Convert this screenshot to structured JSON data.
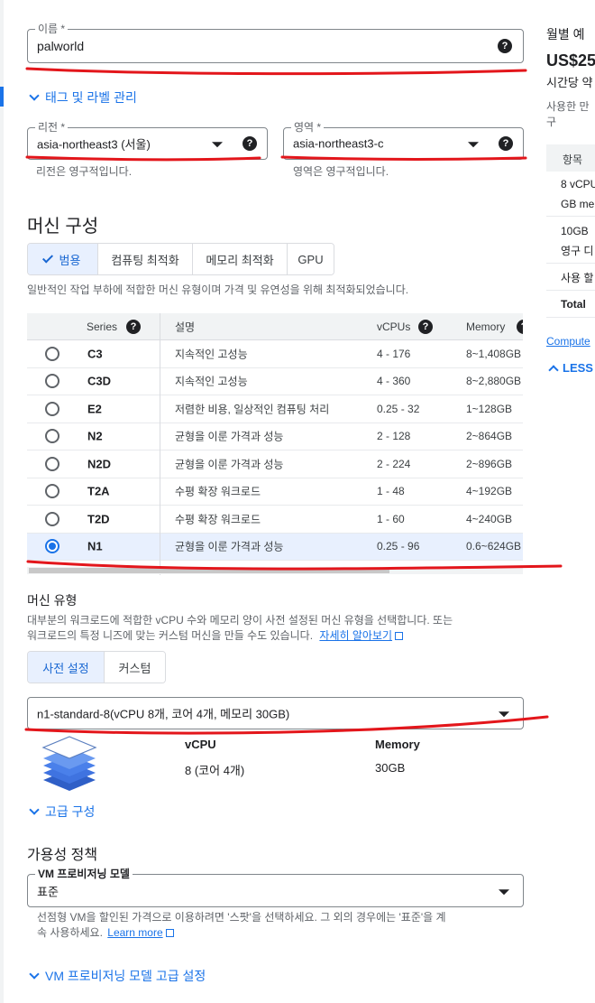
{
  "name_field": {
    "label": "이름 *",
    "value": "palworld"
  },
  "tags_link": "태그 및 라벨 관리",
  "region": {
    "label": "리전 *",
    "value": "asia-northeast3 (서울)",
    "hint": "리전은 영구적입니다."
  },
  "zone": {
    "label": "영역 *",
    "value": "asia-northeast3-c",
    "hint": "영역은 영구적입니다."
  },
  "machine_config": {
    "title": "머신 구성",
    "families": [
      {
        "label": "범용",
        "active": true
      },
      {
        "label": "컴퓨팅 최적화",
        "active": false
      },
      {
        "label": "메모리 최적화",
        "active": false
      },
      {
        "label": "GPU",
        "active": false
      }
    ],
    "family_desc": "일반적인 작업 부하에 적합한 머신 유형이며 가격 및 유연성을 위해 최적화되었습니다.",
    "columns": {
      "series": "Series",
      "desc": "설명",
      "vcpus": "vCPUs",
      "memory": "Memory"
    },
    "series": [
      {
        "name": "C3",
        "desc": "지속적인 고성능",
        "vcpus": "4 - 176",
        "memory": "8~1,408GB",
        "selected": false
      },
      {
        "name": "C3D",
        "desc": "지속적인 고성능",
        "vcpus": "4 - 360",
        "memory": "8~2,880GB",
        "selected": false
      },
      {
        "name": "E2",
        "desc": "저렴한 비용, 일상적인 컴퓨팅 처리",
        "vcpus": "0.25 - 32",
        "memory": "1~128GB",
        "selected": false
      },
      {
        "name": "N2",
        "desc": "균형을 이룬 가격과 성능",
        "vcpus": "2 - 128",
        "memory": "2~864GB",
        "selected": false
      },
      {
        "name": "N2D",
        "desc": "균형을 이룬 가격과 성능",
        "vcpus": "2 - 224",
        "memory": "2~896GB",
        "selected": false
      },
      {
        "name": "T2A",
        "desc": "수평 확장 워크로드",
        "vcpus": "1 - 48",
        "memory": "4~192GB",
        "selected": false
      },
      {
        "name": "T2D",
        "desc": "수평 확장 워크로드",
        "vcpus": "1 - 60",
        "memory": "4~240GB",
        "selected": false
      },
      {
        "name": "N1",
        "desc": "균형을 이룬 가격과 성능",
        "vcpus": "0.25 - 96",
        "memory": "0.6~624GB",
        "selected": true
      }
    ]
  },
  "machine_type": {
    "title": "머신 유형",
    "desc_line1": "대부분의 워크로드에 적합한 vCPU 수와 메모리 양이 사전 설정된 머신 유형을 선택합니다. 또는",
    "desc_line2": "워크로드의 특정 니즈에 맞는 커스텀 머신을 만들 수도 있습니다.",
    "learn_more": "자세히 알아보기",
    "tabs": [
      {
        "label": "사전 설정",
        "active": true
      },
      {
        "label": "커스텀",
        "active": false
      }
    ],
    "selected": "n1-standard-8(vCPU 8개, 코어 4개, 메모리 30GB)",
    "vcpu_label": "vCPU",
    "vcpu_value": "8 (코어 4개)",
    "memory_label": "Memory",
    "memory_value": "30GB"
  },
  "advanced_link": "고급 구성",
  "availability": {
    "title": "가용성 정책",
    "provisioning_label": "VM 프로비저닝 모델",
    "provisioning_value": "표준",
    "desc_line1": "선점형 VM을 할인된 가격으로 이용하려면 '스팟'을 선택하세요. 그 외의 경우에는 '표준'을 계",
    "desc_line2": "속 사용하세요.",
    "learn_more": "Learn more",
    "advanced_link": "VM 프로비저닝 모델 고급 설정"
  },
  "estimate_panel": {
    "title": "월별 예",
    "price": "US$25",
    "hourly": "시간당 약",
    "usage_line1": "사용한 만",
    "usage_line2": "구",
    "col_header": "항목",
    "rows": [
      [
        "8 vCPU",
        "GB me"
      ],
      [
        "10GB",
        "영구 디"
      ],
      [
        "사용 할"
      ]
    ],
    "total": "Total",
    "compute_link": "Compute",
    "less_link": "LESS"
  },
  "colors": {
    "accent": "#1a73e8",
    "annotation": "#e3161b",
    "selected_row": "#e8f0fe"
  },
  "icons": [
    "help-icon",
    "dropdown-caret-icon",
    "chevron-down-icon",
    "chevron-up-icon",
    "check-icon",
    "external-link-icon",
    "layers-icon"
  ]
}
